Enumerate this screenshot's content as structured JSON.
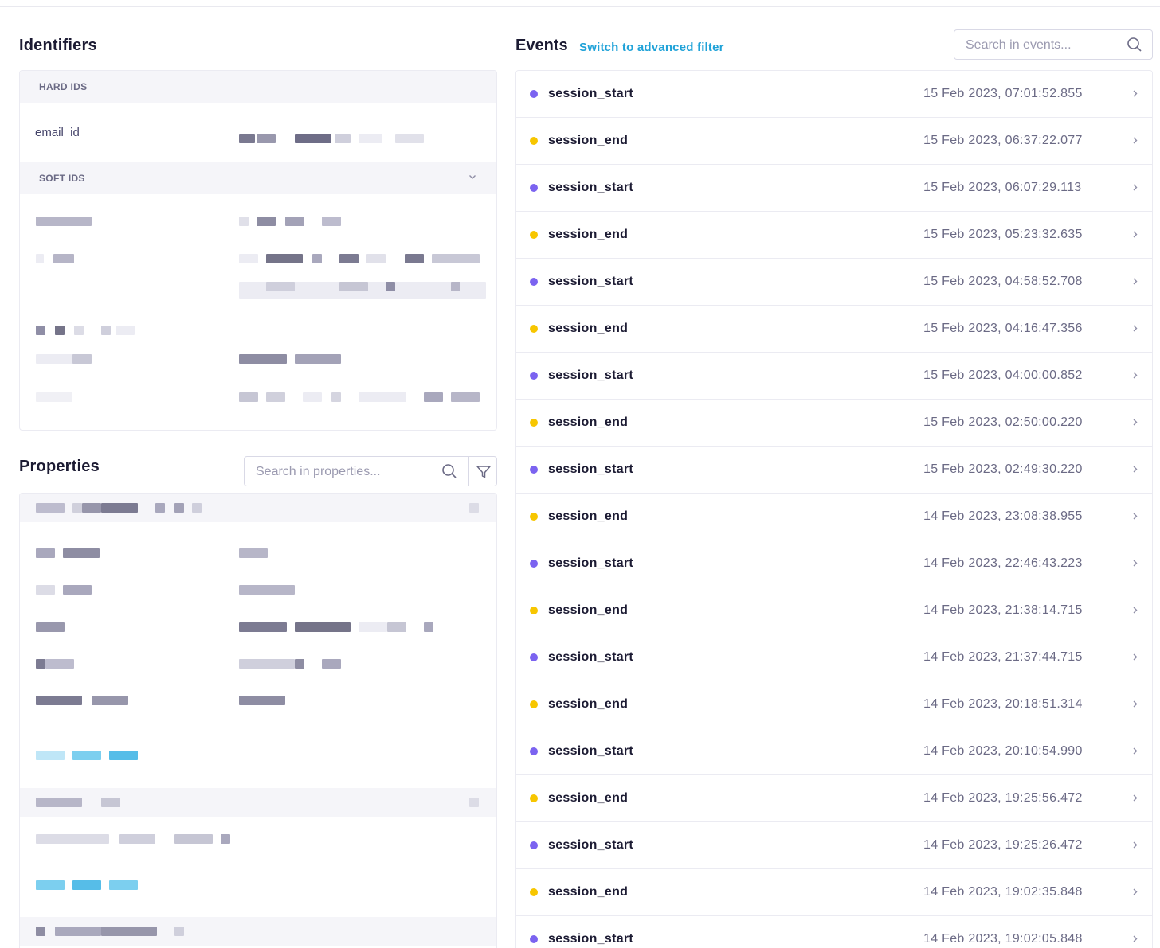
{
  "identifiers": {
    "title": "Identifiers",
    "hard_ids_label": "HARD IDS",
    "email_key": "email_id",
    "soft_ids_label": "SOFT IDS"
  },
  "properties": {
    "title": "Properties",
    "search_placeholder": "Search in properties..."
  },
  "events": {
    "title": "Events",
    "advanced_filter_link": "Switch to advanced filter",
    "search_placeholder": "Search in events...",
    "items": [
      {
        "name": "session_start",
        "time": "15 Feb 2023, 07:01:52.855"
      },
      {
        "name": "session_end",
        "time": "15 Feb 2023, 06:37:22.077"
      },
      {
        "name": "session_start",
        "time": "15 Feb 2023, 06:07:29.113"
      },
      {
        "name": "session_end",
        "time": "15 Feb 2023, 05:23:32.635"
      },
      {
        "name": "session_start",
        "time": "15 Feb 2023, 04:58:52.708"
      },
      {
        "name": "session_end",
        "time": "15 Feb 2023, 04:16:47.356"
      },
      {
        "name": "session_start",
        "time": "15 Feb 2023, 04:00:00.852"
      },
      {
        "name": "session_end",
        "time": "15 Feb 2023, 02:50:00.220"
      },
      {
        "name": "session_start",
        "time": "15 Feb 2023, 02:49:30.220"
      },
      {
        "name": "session_end",
        "time": "14 Feb 2023, 23:08:38.955"
      },
      {
        "name": "session_start",
        "time": "14 Feb 2023, 22:46:43.223"
      },
      {
        "name": "session_end",
        "time": "14 Feb 2023, 21:38:14.715"
      },
      {
        "name": "session_start",
        "time": "14 Feb 2023, 21:37:44.715"
      },
      {
        "name": "session_end",
        "time": "14 Feb 2023, 20:18:51.314"
      },
      {
        "name": "session_start",
        "time": "14 Feb 2023, 20:10:54.990"
      },
      {
        "name": "session_end",
        "time": "14 Feb 2023, 19:25:56.472"
      },
      {
        "name": "session_start",
        "time": "14 Feb 2023, 19:25:26.472"
      },
      {
        "name": "session_end",
        "time": "14 Feb 2023, 19:02:35.848"
      },
      {
        "name": "session_start",
        "time": "14 Feb 2023, 19:02:05.848"
      }
    ]
  },
  "colors": {
    "session_start": "#7b63f0",
    "session_end": "#f7c600",
    "link": "#1fa2d8",
    "redacted_dark": "#6e6d87",
    "redacted_mid": "#a9a8bd",
    "redacted_light": "#e3e3ec",
    "redacted_link": "#56bde8"
  },
  "icons": {
    "search": "search-icon",
    "filter": "filter-icon",
    "chevron_right": "chevron-right-icon",
    "chevron_down": "chevron-down-icon"
  }
}
